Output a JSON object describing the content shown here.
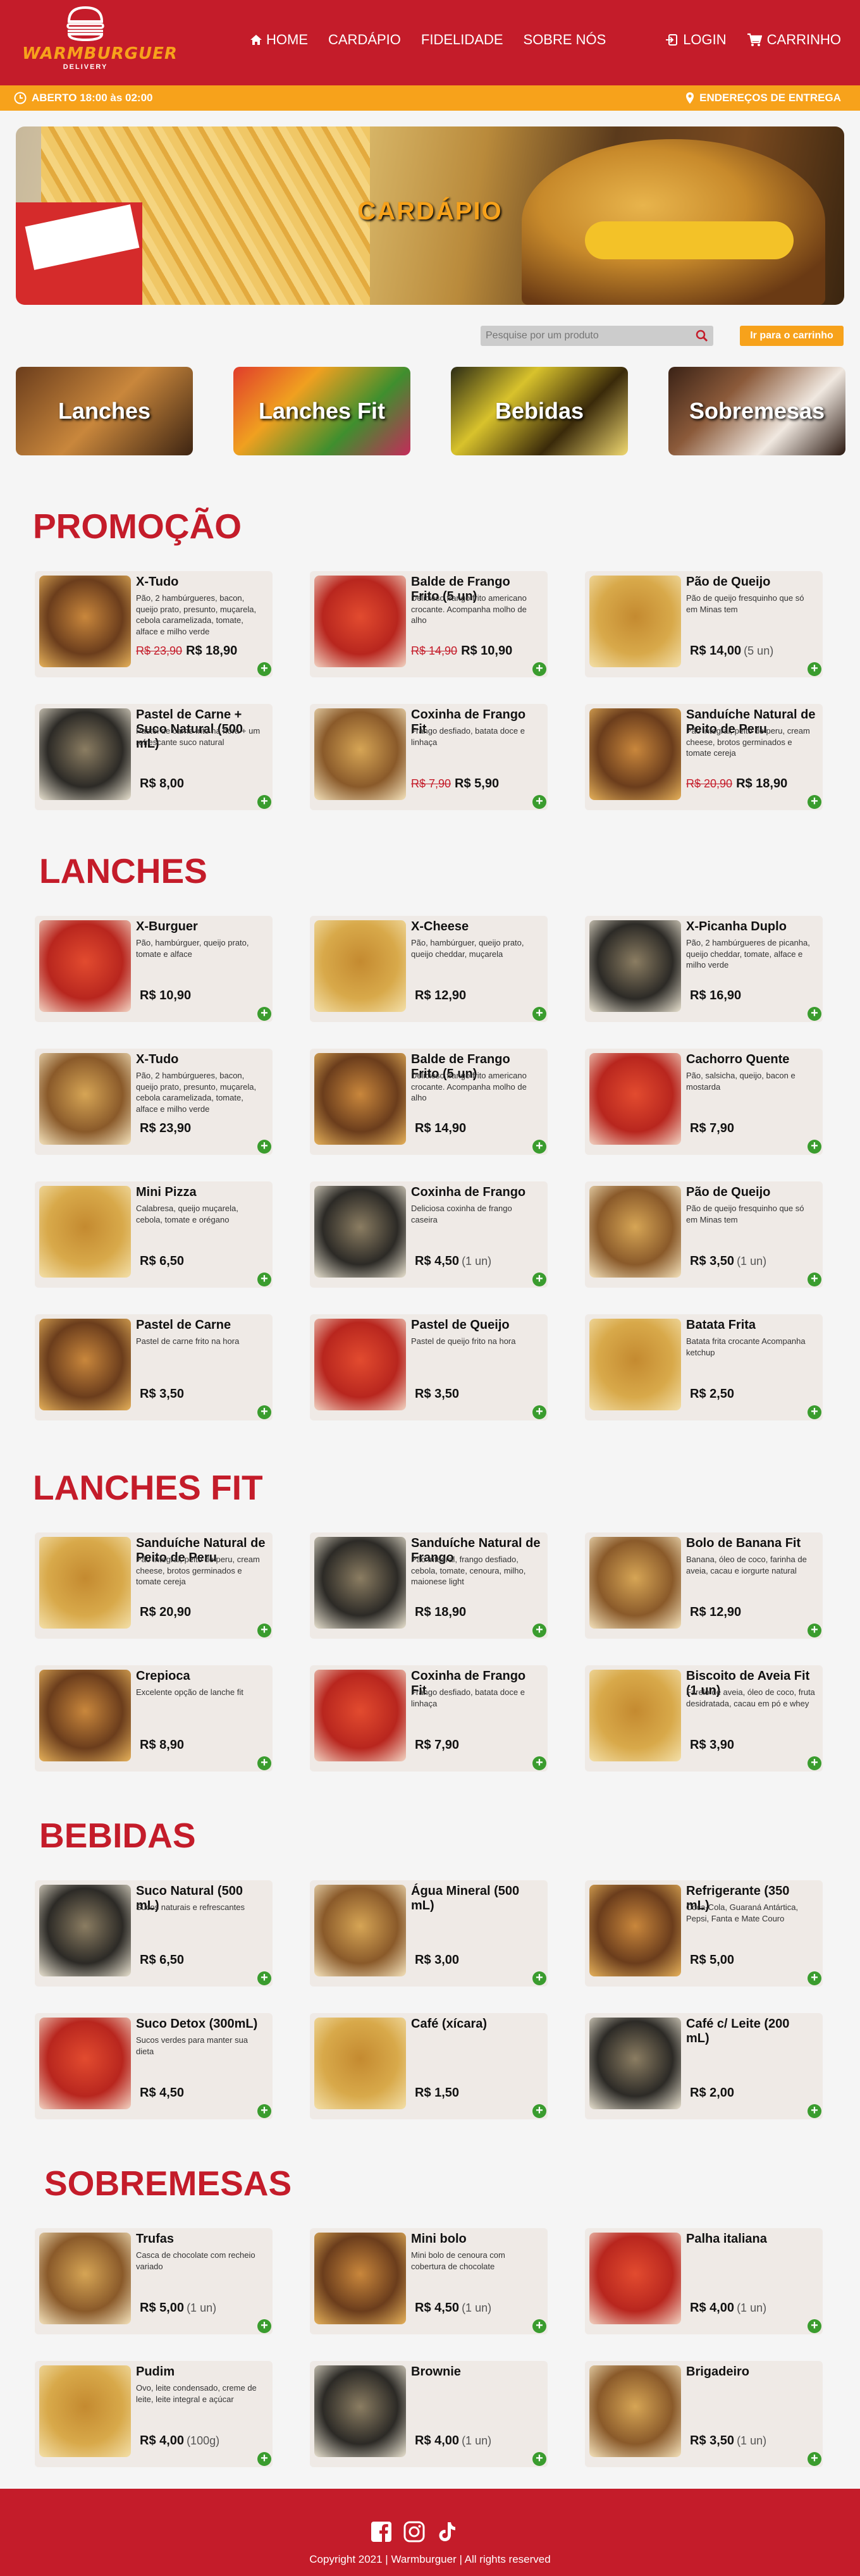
{
  "brand": {
    "name": "WARMBURGUER",
    "tagline": "DELIVERY"
  },
  "nav": [
    {
      "label": "HOME",
      "icon": "home-icon"
    },
    {
      "label": "CARDÁPIO"
    },
    {
      "label": "FIDELIDADE"
    },
    {
      "label": "SOBRE NÓS"
    }
  ],
  "nav_right": {
    "login": "LOGIN",
    "cart": "CARRINHO"
  },
  "status": {
    "open": "ABERTO 18:00 às 02:00",
    "addresses": "ENDEREÇOS DE ENTREGA"
  },
  "banner": {
    "title": "CARDÁPIO"
  },
  "search": {
    "placeholder": "Pesquise por um produto",
    "button": "Ir para o carrinho"
  },
  "categories": [
    "Lanches",
    "Lanches Fit",
    "Bebidas",
    "Sobremesas"
  ],
  "colors": {
    "primary": "#c41c2a",
    "accent": "#f7a21b",
    "add": "#3a9c2e"
  },
  "sections": [
    {
      "title": "PROMOÇÃO",
      "items": [
        {
          "name": "X-Tudo",
          "desc": "Pão, 2 hambúrgueres, bacon, queijo prato, presunto, muçarela, cebola caramelizada, tomate, alface e milho verde",
          "old": "R$ 23,90",
          "price": "R$ 18,90",
          "unit": ""
        },
        {
          "name": "Balde de Frango Frito (5 un)",
          "desc": "Delicioso frango frito americano crocante. Acompanha molho de alho",
          "old": "R$ 14,90",
          "price": "R$ 10,90",
          "unit": ""
        },
        {
          "name": "Pão de Queijo",
          "desc": "Pão de queijo fresquinho que só em Minas tem",
          "old": "",
          "price": "R$ 14,00",
          "unit": "(5 un)"
        },
        {
          "name": "Pastel de Carne + Suco Natural (500 mL)",
          "desc": "Pastel de carne frito na hora + um refrescante suco natural",
          "old": "",
          "price": "R$ 8,00",
          "unit": ""
        },
        {
          "name": "Coxinha de Frango Fit",
          "desc": "Frango desfiado, batata doce e linhaça",
          "old": "R$ 7,90",
          "price": "R$ 5,90",
          "unit": ""
        },
        {
          "name": "Sanduíche Natural de Peito de Peru",
          "desc": "Pão integral, peito de peru, cream cheese, brotos germinados e tomate cereja",
          "old": "R$ 20,90",
          "price": "R$ 18,90",
          "unit": ""
        }
      ]
    },
    {
      "title": "LANCHES",
      "items": [
        {
          "name": "X-Burguer",
          "desc": "Pão, hambúrguer, queijo prato, tomate e alface",
          "old": "",
          "price": "R$ 10,90",
          "unit": ""
        },
        {
          "name": "X-Cheese",
          "desc": "Pão, hambúrguer, queijo prato, queijo cheddar, muçarela",
          "old": "",
          "price": "R$ 12,90",
          "unit": ""
        },
        {
          "name": "X-Picanha Duplo",
          "desc": "Pão, 2 hambúrgueres de picanha, queijo cheddar, tomate, alface e milho verde",
          "old": "",
          "price": "R$ 16,90",
          "unit": ""
        },
        {
          "name": "X-Tudo",
          "desc": "Pão, 2 hambúrgueres, bacon, queijo prato, presunto, muçarela, cebola caramelizada, tomate, alface e milho verde",
          "old": "",
          "price": "R$ 23,90",
          "unit": ""
        },
        {
          "name": "Balde de Frango Frito (5 un)",
          "desc": "Delicioso frango frito americano crocante. Acompanha molho de alho",
          "old": "",
          "price": "R$ 14,90",
          "unit": ""
        },
        {
          "name": "Cachorro Quente",
          "desc": "Pão, salsicha, queijo, bacon e mostarda",
          "old": "",
          "price": "R$ 7,90",
          "unit": ""
        },
        {
          "name": "Mini Pizza",
          "desc": "Calabresa, queijo muçarela, cebola, tomate e orégano",
          "old": "",
          "price": "R$ 6,50",
          "unit": ""
        },
        {
          "name": "Coxinha de Frango",
          "desc": "Deliciosa coxinha de frango caseira",
          "old": "",
          "price": "R$ 4,50",
          "unit": "(1 un)"
        },
        {
          "name": "Pão de Queijo",
          "desc": "Pão de queijo fresquinho que só em Minas tem",
          "old": "",
          "price": "R$ 3,50",
          "unit": "(1 un)"
        },
        {
          "name": "Pastel de Carne",
          "desc": "Pastel de carne frito na hora",
          "old": "",
          "price": "R$ 3,50",
          "unit": ""
        },
        {
          "name": "Pastel de Queijo",
          "desc": "Pastel de queijo frito na hora",
          "old": "",
          "price": "R$ 3,50",
          "unit": ""
        },
        {
          "name": "Batata Frita",
          "desc": "Batata frita crocante Acompanha ketchup",
          "old": "",
          "price": "R$ 2,50",
          "unit": ""
        }
      ]
    },
    {
      "title": "LANCHES FIT",
      "items": [
        {
          "name": "Sanduíche Natural de Peito de Peru",
          "desc": "Pão integral, peito de peru, cream cheese, brotos germinados e tomate cereja",
          "old": "",
          "price": "R$ 20,90",
          "unit": ""
        },
        {
          "name": "Sanduíche Natural de Frango",
          "desc": "Pão integral, frango desfiado, cebola, tomate, cenoura, milho, maionese light",
          "old": "",
          "price": "R$ 18,90",
          "unit": ""
        },
        {
          "name": "Bolo de Banana Fit",
          "desc": "Banana, óleo de coco, farinha de aveia, cacau e iorgurte natural",
          "old": "",
          "price": "R$ 12,90",
          "unit": ""
        },
        {
          "name": "Crepioca",
          "desc": "Excelente opção de lanche fit",
          "old": "",
          "price": "R$ 8,90",
          "unit": ""
        },
        {
          "name": "Coxinha de Frango Fit",
          "desc": "Frango desfiado, batata doce e linhaça",
          "old": "",
          "price": "R$ 7,90",
          "unit": ""
        },
        {
          "name": "Biscoito de Aveia Fit (1 un)",
          "desc": "Farelo de aveia, óleo de coco, fruta desidratada, cacau em pó e whey",
          "old": "",
          "price": "R$ 3,90",
          "unit": ""
        }
      ]
    },
    {
      "title": "BEBIDAS",
      "items": [
        {
          "name": "Suco Natural (500 mL)",
          "desc": "Sucos naturais e refrescantes",
          "old": "",
          "price": "R$ 6,50",
          "unit": ""
        },
        {
          "name": "Água Mineral (500 mL)",
          "desc": "",
          "old": "",
          "price": "R$ 3,00",
          "unit": ""
        },
        {
          "name": "Refrigerante (350 mL)",
          "desc": "Coca-Cola, Guaraná Antártica, Pepsi, Fanta e Mate Couro",
          "old": "",
          "price": "R$ 5,00",
          "unit": ""
        },
        {
          "name": "Suco Detox (300mL)",
          "desc": "Sucos verdes para manter sua dieta",
          "old": "",
          "price": "R$ 4,50",
          "unit": ""
        },
        {
          "name": "Café (xícara)",
          "desc": "",
          "old": "",
          "price": "R$ 1,50",
          "unit": ""
        },
        {
          "name": "Café c/ Leite (200 mL)",
          "desc": "",
          "old": "",
          "price": "R$ 2,00",
          "unit": ""
        }
      ]
    },
    {
      "title": "SOBREMESAS",
      "items": [
        {
          "name": "Trufas",
          "desc": "Casca de chocolate com recheio variado",
          "old": "",
          "price": "R$ 5,00",
          "unit": "(1 un)"
        },
        {
          "name": "Mini bolo",
          "desc": "Mini bolo de cenoura com cobertura de chocolate",
          "old": "",
          "price": "R$ 4,50",
          "unit": "(1 un)"
        },
        {
          "name": "Palha italiana",
          "desc": "",
          "old": "",
          "price": "R$ 4,00",
          "unit": "(1 un)"
        },
        {
          "name": "Pudim",
          "desc": "Ovo, leite condensado, creme de leite, leite integral e açúcar",
          "old": "",
          "price": "R$ 4,00",
          "unit": "(100g)"
        },
        {
          "name": "Brownie",
          "desc": "",
          "old": "",
          "price": "R$ 4,00",
          "unit": "(1 un)"
        },
        {
          "name": "Brigadeiro",
          "desc": "",
          "old": "",
          "price": "R$ 3,50",
          "unit": "(1 un)"
        }
      ]
    }
  ],
  "footer": {
    "copyright": "Copyright 2021 | Warmburguer | All rights reserved",
    "social": [
      "facebook-icon",
      "instagram-icon",
      "tiktok-icon"
    ]
  }
}
